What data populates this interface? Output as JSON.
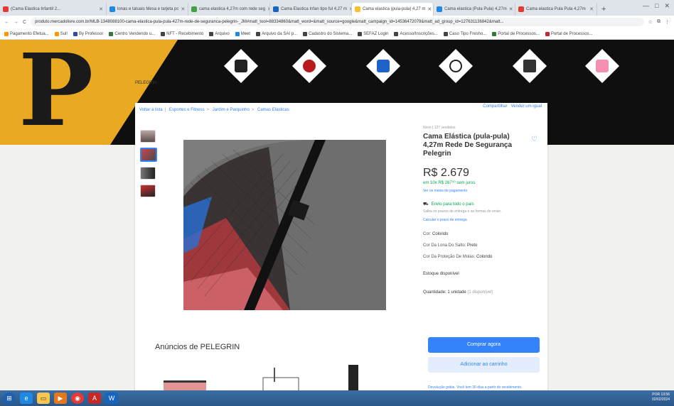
{
  "tabs": [
    {
      "label": "(Cama Elastica Infantil 2...",
      "color": "#e53935"
    },
    {
      "label": "lonas e tatuais Mesa e tarjeta pc",
      "color": "#1e88e5"
    },
    {
      "label": "cama elastica 4,27m com rede seg",
      "color": "#43a047"
    },
    {
      "label": "Cama Elastica Infan tipo ful 4,27 m",
      "color": "#1565c0"
    },
    {
      "label": "Cama elastica (pula-pula) 4,27 m",
      "color": "#fbc02d"
    },
    {
      "label": "Cama elastica (Pula Pula) 4,27m",
      "color": "#1e88e5"
    },
    {
      "label": "Cama elastica Pula Pula 4,27m",
      "color": "#e53935"
    }
  ],
  "browser": {
    "newtab": "+",
    "url": "produto.mercadolivre.com.br/MLB-1348088100-cama-elastica-pula-pula-427m-rede-de-seguranca-pelegrin-_JM#matt_tool=88334860&matt_word=&matt_source=google&matt_campaign_id=14536472079&matt_ad_group_id=127631136842&matt...",
    "back": "←",
    "forward": "→",
    "reload": "C",
    "home": "⌂"
  },
  "bookmarks": [
    {
      "label": "Pagamento Efetua...",
      "color": "#ff9800"
    },
    {
      "label": "Sul!",
      "color": "#ff9800"
    },
    {
      "label": "By Professor",
      "color": "#3949ab"
    },
    {
      "label": "Centro Vendendo u...",
      "color": "#2e7d32"
    },
    {
      "label": "NFT - Recebimento",
      "color": "#444"
    },
    {
      "label": "Arquivo",
      "color": "#444"
    },
    {
      "label": "Meet",
      "color": "#1e88e5"
    },
    {
      "label": "Arquivo da SAI p...",
      "color": "#444"
    },
    {
      "label": "Cadastro do Sistema...",
      "color": "#444"
    },
    {
      "label": "SEFAZ Login",
      "color": "#444"
    },
    {
      "label": "Acesso/Inscrições...",
      "color": "#444"
    },
    {
      "label": "Caso Tipo Fresho...",
      "color": "#444"
    },
    {
      "label": "Portal de Processos...",
      "color": "#2e7d32"
    },
    {
      "label": "Portal de Processos...",
      "color": "#c62828"
    }
  ],
  "banner": {
    "letter": "P",
    "logo_text": "PELEGRIN"
  },
  "breadcrumb": [
    "Voltar à lista",
    "Esportes e Fitness",
    "Jardim e Parquinho",
    "Camas Elásticas"
  ],
  "share_links": [
    "Compartilhar",
    "Vender um igual"
  ],
  "product": {
    "condition": "Novo | 127 vendidos",
    "title": "Cama Elástica (pula-pula) 4,27m Rede De Segurança Pelegrin",
    "price": "R$ 2.679",
    "installments": "em 10x R$ 267⁹⁰ sem juros",
    "payment_link": "Ver os meios de pagamento",
    "shipping_title": "Envio para todo o país",
    "shipping_note": "Saiba os prazos de entrega e as formas de envio.",
    "shipping_link": "Calcular o prazo de entrega",
    "attributes": [
      {
        "label": "Cor:",
        "value": "Colorido"
      },
      {
        "label": "Cor Da Lona Do Salto:",
        "value": "Preto"
      },
      {
        "label": "Cor Da Proteção De Molas:",
        "value": "Colorido"
      }
    ],
    "stock": "Estoque disponível",
    "quantity_label": "Quantidade: 1 unidade",
    "quantity_available": "(1 disponível)",
    "buy_button": "Comprar agora",
    "cart_button": "Adicionar ao carrinho",
    "footer_link": "Devolução grátis. Você tem 30 dias a partir do recebimento."
  },
  "seller_ads_title": "Anúncios de PELEGRIN",
  "tray": {
    "lang": "POR",
    "time": "13:56",
    "date": "02/02/2024"
  },
  "icons": {
    "heart": "heart-icon",
    "truck": "truck-icon"
  }
}
